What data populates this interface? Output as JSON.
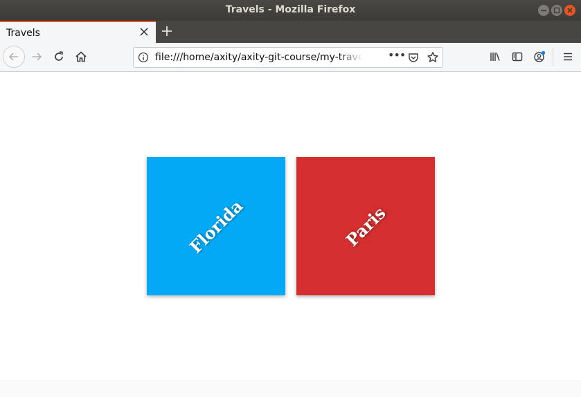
{
  "window": {
    "title": "Travels - Mozilla Firefox"
  },
  "tab": {
    "label": "Travels"
  },
  "address_bar": {
    "url": "file:///home/axity/axity-git-course/my-travel-p",
    "more_label": "•••"
  },
  "cards": [
    {
      "label": "Florida",
      "color": "#03a9f4"
    },
    {
      "label": "Paris",
      "color": "#d32f2f"
    }
  ]
}
